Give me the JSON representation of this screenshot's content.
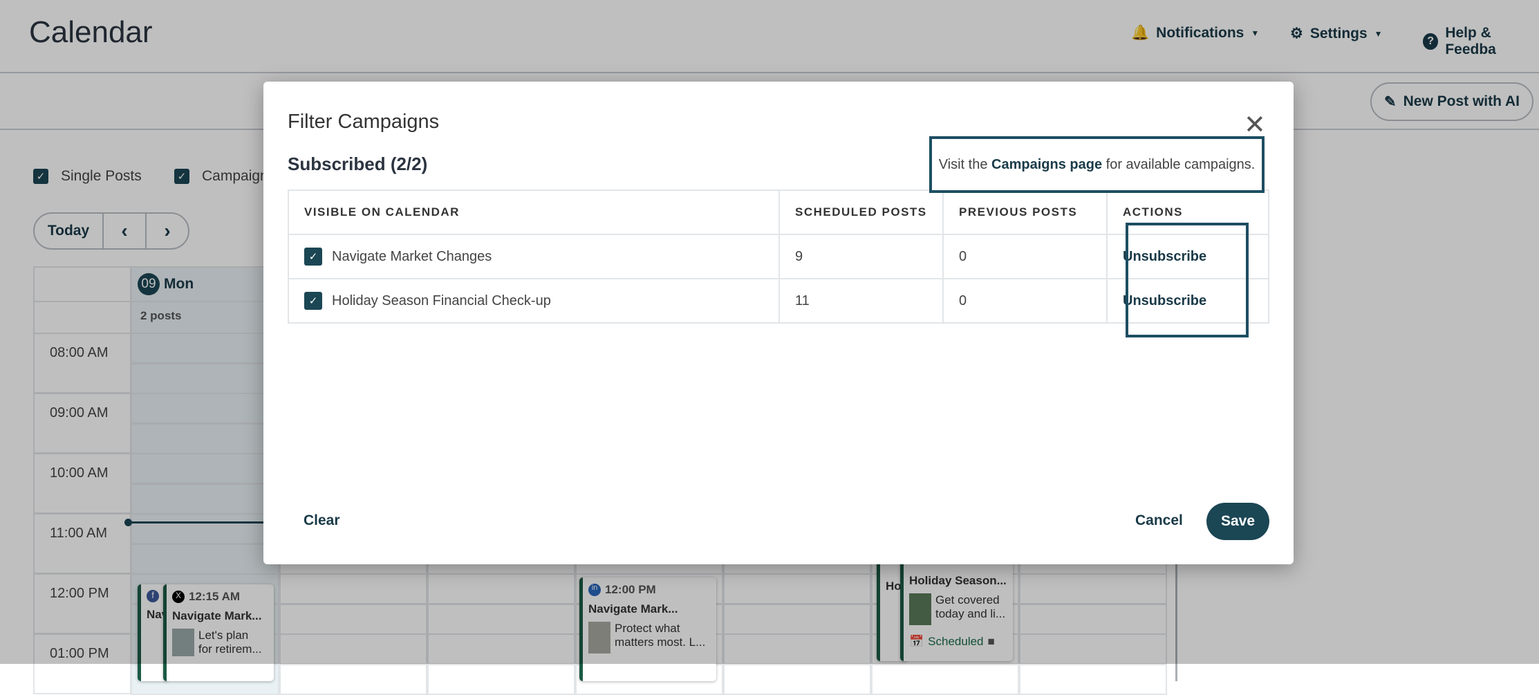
{
  "header": {
    "title": "Calendar",
    "notifications": "Notifications",
    "settings": "Settings",
    "help": "Help & Feedba"
  },
  "toolbar": {
    "new_post": "New Post with AI"
  },
  "filters": {
    "single_posts": "Single Posts",
    "campaigns": "Campaign"
  },
  "nav": {
    "today": "Today",
    "prev": "‹",
    "next": "›"
  },
  "calendar": {
    "day_num": "09",
    "day_name": "Mon",
    "post_count": "2 posts",
    "times": [
      "08:00 AM",
      "09:00 AM",
      "10:00 AM",
      "11:00 AM",
      "12:00 PM",
      "01:00 PM"
    ],
    "cards": [
      {
        "time": "12:15 AM",
        "title": "Navigate Mark...",
        "text1": "Let's plan",
        "text2": "for retirem...",
        "partial": "Nav"
      },
      {
        "time": "12:00 PM",
        "title": "Navigate Mark...",
        "text1": "Protect what",
        "text2": "matters most. L..."
      },
      {
        "title": "Holiday Season...",
        "text1": "Get covered",
        "text2": "today and li...",
        "status": "Scheduled",
        "partial": "Ho"
      }
    ]
  },
  "modal": {
    "title": "Filter Campaigns",
    "subtitle": "Subscribed (2/2)",
    "visit_pre": "Visit the ",
    "visit_link": "Campaigns page",
    "visit_post": " for available campaigns.",
    "columns": [
      "VISIBLE ON CALENDAR",
      "SCHEDULED POSTS",
      "PREVIOUS POSTS",
      "ACTIONS"
    ],
    "rows": [
      {
        "name": "Navigate Market Changes",
        "scheduled": "9",
        "previous": "0",
        "action": "Unsubscribe",
        "checked": true
      },
      {
        "name": "Holiday Season Financial Check-up",
        "scheduled": "11",
        "previous": "0",
        "action": "Unsubscribe",
        "checked": true
      }
    ],
    "clear": "Clear",
    "cancel": "Cancel",
    "save": "Save"
  },
  "colors": {
    "primary": "#1b4654",
    "card_accent": "#1b5a44"
  }
}
